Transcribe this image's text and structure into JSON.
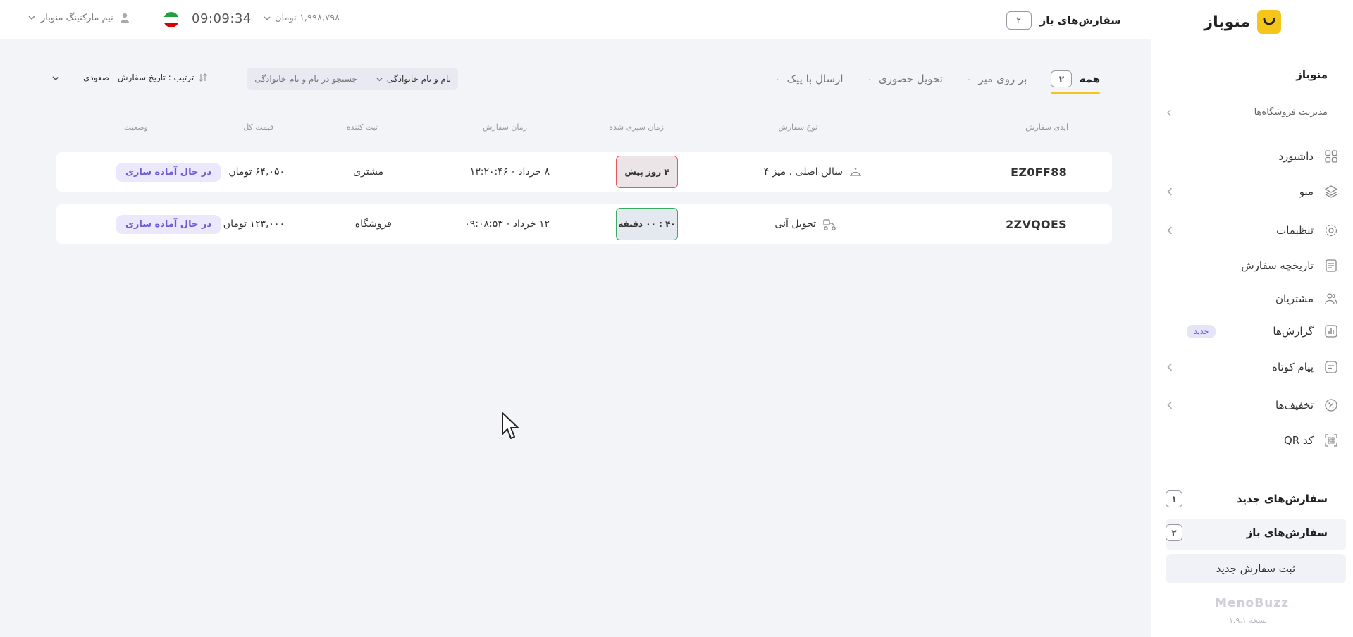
{
  "topbar": {
    "open_orders_label": "سفارش‌های باز",
    "open_orders_count": "۲",
    "user_name": "تیم مارکتینگ منوباز",
    "clock": "09:09:34",
    "balance": "۱,۹۹۸,۷۹۸ تومان"
  },
  "tabs": [
    {
      "label": "همه",
      "count": "۲"
    },
    {
      "label": "بر روی میز",
      "count": "۰"
    },
    {
      "label": "تحویل حضوری",
      "count": "۰"
    },
    {
      "label": "ارسال با پیک",
      "count": "۰"
    }
  ],
  "controls": {
    "sort_label": "ترتیب : تاریخ سفارش - صعودی",
    "search_placeholder": "جستجو در نام و نام خانوادگی",
    "search_field": "نام و نام خانوادگی"
  },
  "table": {
    "headers": {
      "order_id": "آیدی سفارش",
      "order_type": "نوع سفارش",
      "elapsed": "زمان سپری شده",
      "order_time": "زمان سفارش",
      "registered_by": "ثبت کننده",
      "total": "قیمت کل",
      "status": "وضعیت"
    },
    "rows": [
      {
        "order_id": "EZ0FF88",
        "order_type": "سالن اصلی ، میز ۴",
        "elapsed": "۴ روز پیش",
        "order_time": "۸ خرداد - ۱۳:۲۰:۴۶",
        "registered_by": "مشتری",
        "total": "۶۴,۰۵۰ تومان",
        "status": "در حال آماده سازی"
      },
      {
        "order_id": "2ZVQOES",
        "order_type": "تحویل آنی",
        "elapsed": "۴۰ : ۰۰ دقیقه",
        "order_time": "۱۲ خرداد - ۰۹:۰۸:۵۳",
        "registered_by": "فروشگاه",
        "total": "۱۲۳,۰۰۰ تومان",
        "status": "در حال آماده سازی"
      }
    ]
  },
  "sidebar": {
    "brand": "منوباز",
    "title": "منوباز",
    "shop_management": "مدیریت فروشگاه‌ها",
    "items": [
      {
        "label": "داشبورد",
        "icon": "dashboard-icon"
      },
      {
        "label": "منو",
        "icon": "layers-icon"
      },
      {
        "label": "تنظیمات",
        "icon": "gear-icon"
      },
      {
        "label": "تاریخچه سفارش",
        "icon": "receipt-icon"
      },
      {
        "label": "مشتریان",
        "icon": "users-icon"
      },
      {
        "label": "گزارش‌ها",
        "icon": "chart-icon",
        "badge": "جدید"
      },
      {
        "label": "پیام کوتاه",
        "icon": "message-icon"
      },
      {
        "label": "تخفیف‌ها",
        "icon": "discount-icon"
      },
      {
        "label": "کد QR",
        "icon": "qr-icon"
      }
    ],
    "new_orders_label": "سفارش‌های جدید",
    "new_orders_count": "۱",
    "open_orders_label": "سفارش‌های باز",
    "open_orders_count": "۲",
    "new_order_button": "ثبت سفارش جدید",
    "footer_logo": "MenoBuzz",
    "version": "نسخه ۱.۹.۱"
  },
  "colors": {
    "accent": "#f5c51a",
    "status_purple": "#6a5bd6",
    "late_red": "#e25a5a",
    "ok_green": "#3aab65"
  }
}
